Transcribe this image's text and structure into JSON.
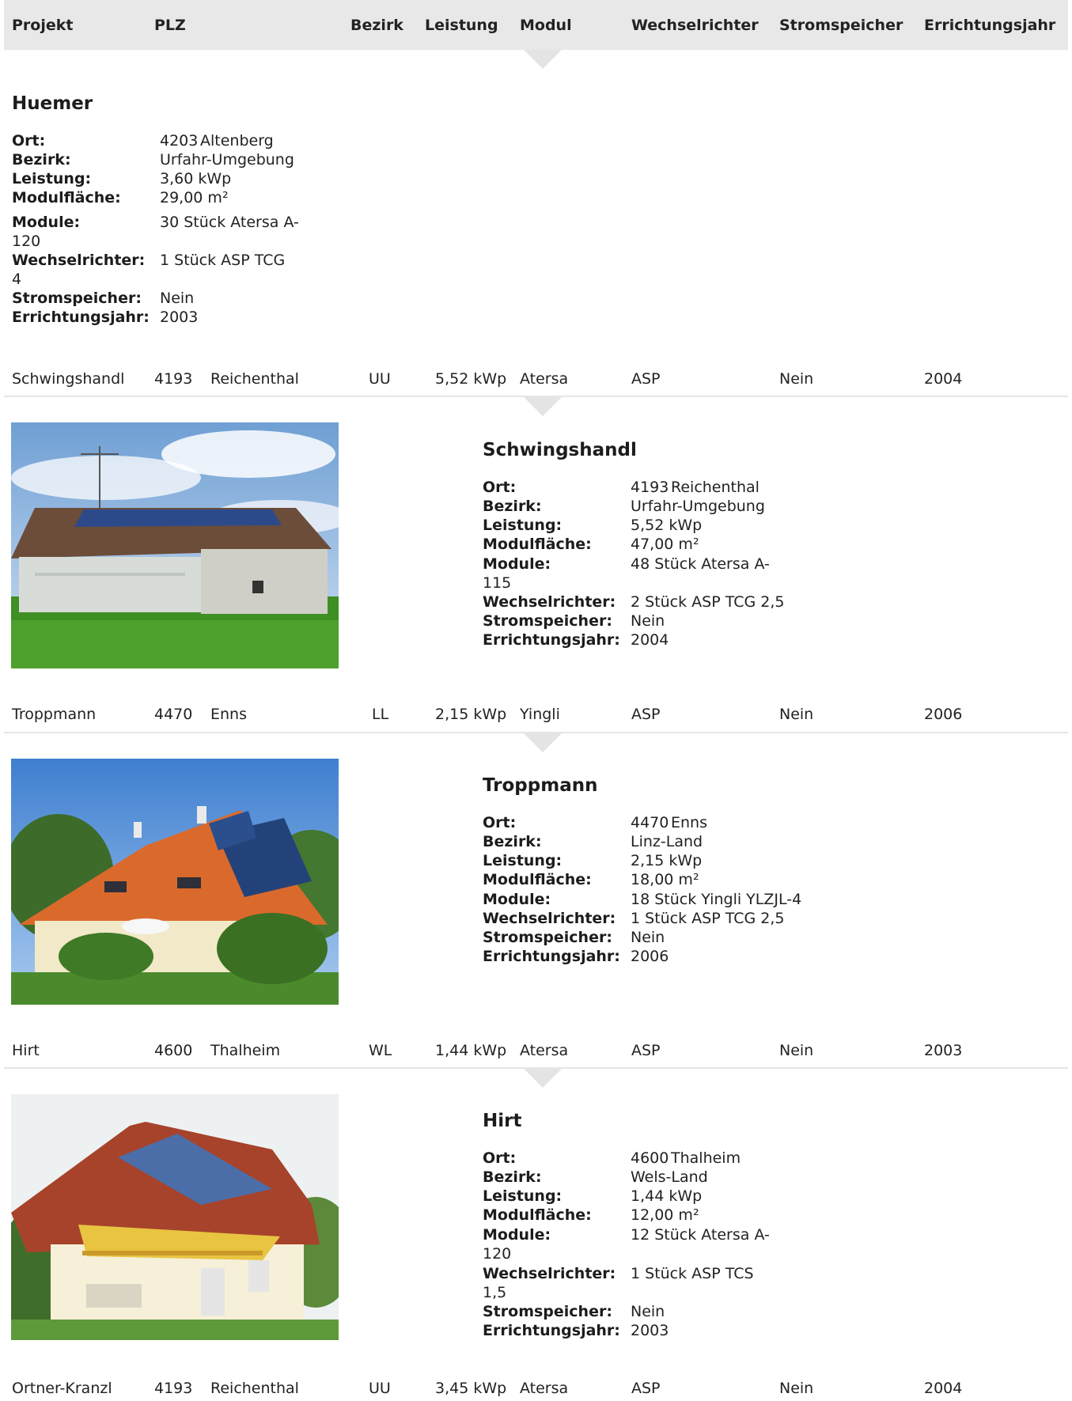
{
  "columns": {
    "projekt": "Projekt",
    "plz": "PLZ",
    "bezirk": "Bezirk",
    "leistung": "Leistung",
    "modul": "Modul",
    "wechselrichter": "Wechselrichter",
    "stromspeicher": "Stromspeicher",
    "errichtungsjahr": "Errichtungsjahr"
  },
  "labels": {
    "ort": "Ort:",
    "bezirk": "Bezirk:",
    "leistung": "Leistung:",
    "modulflaeche": "Modulfläche:",
    "module": "Module:",
    "wechselrichter": "Wechselrichter:",
    "stromspeicher": "Stromspeicher:",
    "errichtungsjahr": "Errichtungsjahr:"
  },
  "huemer": {
    "title": "Huemer",
    "plz": "4203",
    "ort": "Altenberg",
    "bezirk": "Urfahr-Umgebung",
    "leistung": "3,60 kWp",
    "modulflaeche": "29,00 m²",
    "module_a": "30 Stück Atersa A-",
    "module_b": "120",
    "wechselrichter_a": "1 Stück ASP TCG",
    "wechselrichter_b": "4",
    "stromspeicher": "Nein",
    "errichtungsjahr": "2003"
  },
  "rows": [
    {
      "projekt": "Schwingshandl",
      "plz": "4193",
      "ort": "Reichenthal",
      "bezirk": "UU",
      "leistung": "5,52 kWp",
      "modul": "Atersa",
      "wechselrichter": "ASP",
      "stromspeicher": "Nein",
      "jahr": "2004"
    },
    {
      "projekt": "Troppmann",
      "plz": "4470",
      "ort": "Enns",
      "bezirk": "LL",
      "leistung": "2,15 kWp",
      "modul": "Yingli",
      "wechselrichter": "ASP",
      "stromspeicher": "Nein",
      "jahr": "2006"
    },
    {
      "projekt": "Hirt",
      "plz": "4600",
      "ort": "Thalheim",
      "bezirk": "WL",
      "leistung": "1,44 kWp",
      "modul": "Atersa",
      "wechselrichter": "ASP",
      "stromspeicher": "Nein",
      "jahr": "2003"
    },
    {
      "projekt": "Ortner-Kranzl",
      "plz": "4193",
      "ort": "Reichenthal",
      "bezirk": "UU",
      "leistung": "3,45 kWp",
      "modul": "Atersa",
      "wechselrichter": "ASP",
      "stromspeicher": "Nein",
      "jahr": "2004"
    }
  ],
  "details": [
    {
      "title": "Schwingshandl",
      "plz": "4193",
      "ort": "Reichenthal",
      "bezirk": "Urfahr-Umgebung",
      "leistung": "5,52 kWp",
      "modulflaeche": "47,00 m²",
      "module_a": "48 Stück Atersa A-",
      "module_b": "115",
      "wechselrichter_a": "2 Stück ASP TCG 2,5",
      "wechselrichter_b": "",
      "stromspeicher": "Nein",
      "errichtungsjahr": "2004"
    },
    {
      "title": "Troppmann",
      "plz": "4470",
      "ort": "Enns",
      "bezirk": "Linz-Land",
      "leistung": "2,15 kWp",
      "modulflaeche": "18,00 m²",
      "module_a": "18 Stück Yingli YLZJL-4",
      "module_b": "",
      "wechselrichter_a": "1 Stück ASP TCG 2,5",
      "wechselrichter_b": "",
      "stromspeicher": "Nein",
      "errichtungsjahr": "2006"
    },
    {
      "title": "Hirt",
      "plz": "4600",
      "ort": "Thalheim",
      "bezirk": "Wels-Land",
      "leistung": "1,44 kWp",
      "modulflaeche": "12,00 m²",
      "module_a": "12 Stück Atersa A-",
      "module_b": "120",
      "wechselrichter_a": "1 Stück ASP TCS",
      "wechselrichter_b": "1,5",
      "stromspeicher": "Nein",
      "errichtungsjahr": "2003"
    }
  ]
}
